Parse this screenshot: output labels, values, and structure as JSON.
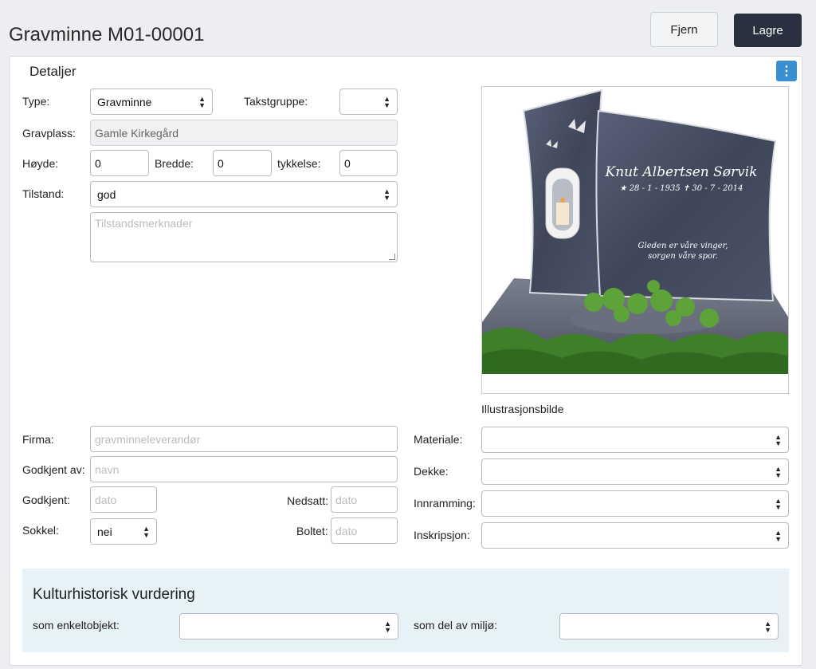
{
  "header": {
    "title": "Gravminne M01-00001",
    "remove_label": "Fjern",
    "save_label": "Lagre"
  },
  "details": {
    "section_title": "Detaljer",
    "menu_icon": "kebab-icon",
    "type": {
      "label": "Type:",
      "value": "Gravminne"
    },
    "takstgruppe": {
      "label": "Takstgruppe:",
      "value": ""
    },
    "gravplass": {
      "label": "Gravplass:",
      "value": "Gamle Kirkegård"
    },
    "hoyde": {
      "label": "Høyde:",
      "value": "0"
    },
    "bredde": {
      "label": "Bredde:",
      "value": "0"
    },
    "tykkelse": {
      "label": "tykkelse:",
      "value": "0"
    },
    "tilstand": {
      "label": "Tilstand:",
      "value": "god"
    },
    "tilstand_notes": {
      "placeholder": "Tilstandsmerknader"
    },
    "image_caption": "Illustrasjonsbilde",
    "engraving": {
      "name": "Knut Albertsen Sørvik",
      "dates": "★ 28 - 1 - 1935   ✝ 30 - 7 - 2014",
      "verse_line1": "Gleden er våre vinger,",
      "verse_line2": "sorgen våre spor."
    },
    "firma": {
      "label": "Firma:",
      "placeholder": "gravminneleverandør"
    },
    "godkjent_av": {
      "label": "Godkjent av:",
      "placeholder": "navn"
    },
    "godkjent": {
      "label": "Godkjent:",
      "placeholder": "dato"
    },
    "nedsatt": {
      "label": "Nedsatt:",
      "placeholder": "dato"
    },
    "sokkel": {
      "label": "Sokkel:",
      "value": "nei"
    },
    "boltet": {
      "label": "Boltet:",
      "placeholder": "dato"
    },
    "materiale": {
      "label": "Materiale:",
      "value": ""
    },
    "dekke": {
      "label": "Dekke:",
      "value": ""
    },
    "innramming": {
      "label": "Innramming:",
      "value": ""
    },
    "inskripsjon": {
      "label": "Inskripsjon:",
      "value": ""
    }
  },
  "kultur": {
    "title": "Kulturhistorisk vurdering",
    "enkeltobjekt": {
      "label": "som enkeltobjekt:",
      "value": ""
    },
    "miljo": {
      "label": "som del av miljø:",
      "value": ""
    }
  }
}
